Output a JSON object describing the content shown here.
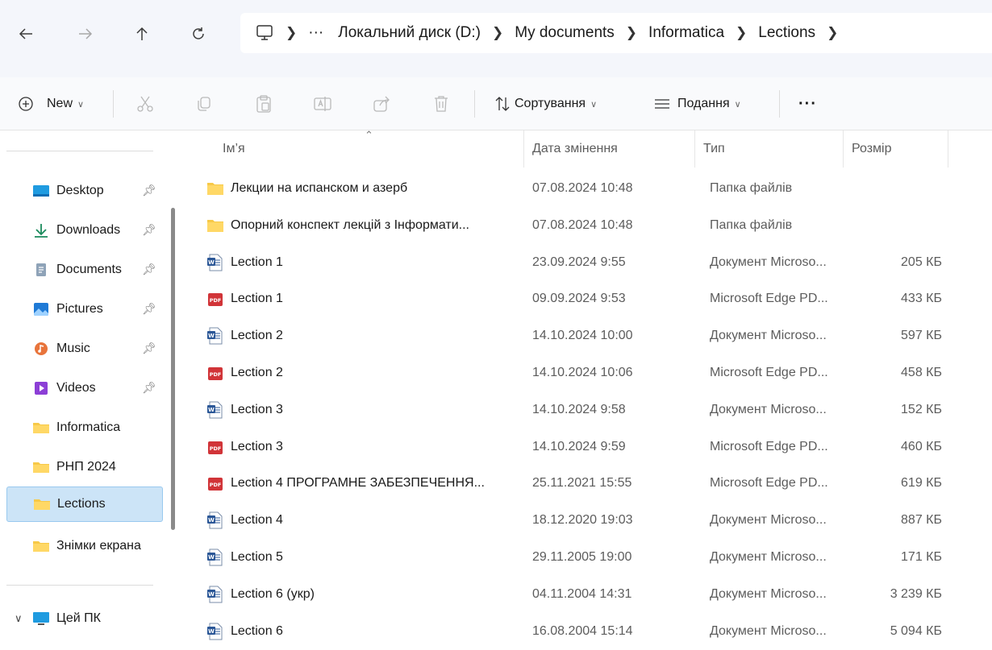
{
  "address_bar": {
    "segments": [
      "Локальний диск (D:)",
      "My documents",
      "Informatica",
      "Lections"
    ],
    "ellipsis": "···"
  },
  "toolbar": {
    "new_label": "New",
    "sort_label": "Сортування",
    "view_label": "Подання",
    "more_label": "···"
  },
  "sidebar": {
    "items": [
      {
        "label": "Desktop",
        "icon": "desktop-icon",
        "pinned": true
      },
      {
        "label": "Downloads",
        "icon": "download-icon",
        "pinned": true
      },
      {
        "label": "Documents",
        "icon": "documents-icon",
        "pinned": true
      },
      {
        "label": "Pictures",
        "icon": "pictures-icon",
        "pinned": true
      },
      {
        "label": "Music",
        "icon": "music-icon",
        "pinned": true
      },
      {
        "label": "Videos",
        "icon": "videos-icon",
        "pinned": true
      },
      {
        "label": "Informatica",
        "icon": "folder-icon",
        "pinned": false
      },
      {
        "label": "РНП 2024",
        "icon": "folder-icon",
        "pinned": false
      },
      {
        "label": "Lections",
        "icon": "folder-icon",
        "pinned": false,
        "selected": true
      },
      {
        "label": "Знімки екрана",
        "icon": "folder-icon",
        "pinned": false
      }
    ],
    "this_pc": "Цей ПК"
  },
  "columns": {
    "name": "Ім’я",
    "date": "Дата змінення",
    "type": "Тип",
    "size": "Розмір"
  },
  "files": [
    {
      "name": "Лекции на испанском и азерб",
      "date": "07.08.2024 10:48",
      "type": "Папка файлів",
      "size": "",
      "icon": "folder"
    },
    {
      "name": "Опорний конспект лекцій з Інформати...",
      "date": "07.08.2024 10:48",
      "type": "Папка файлів",
      "size": "",
      "icon": "folder"
    },
    {
      "name": "Lection 1",
      "date": "23.09.2024 9:55",
      "type": "Документ Microso...",
      "size": "205 КБ",
      "icon": "word"
    },
    {
      "name": "Lection 1",
      "date": "09.09.2024 9:53",
      "type": "Microsoft Edge PD...",
      "size": "433 КБ",
      "icon": "pdf"
    },
    {
      "name": "Lection 2",
      "date": "14.10.2024 10:00",
      "type": "Документ Microso...",
      "size": "597 КБ",
      "icon": "word"
    },
    {
      "name": "Lection 2",
      "date": "14.10.2024 10:06",
      "type": "Microsoft Edge PD...",
      "size": "458 КБ",
      "icon": "pdf"
    },
    {
      "name": "Lection 3",
      "date": "14.10.2024 9:58",
      "type": "Документ Microso...",
      "size": "152 КБ",
      "icon": "word"
    },
    {
      "name": "Lection 3",
      "date": "14.10.2024 9:59",
      "type": "Microsoft Edge PD...",
      "size": "460 КБ",
      "icon": "pdf"
    },
    {
      "name": "Lection 4 ПРОГРАМНЕ  ЗАБЕЗПЕЧЕННЯ...",
      "date": "25.11.2021 15:55",
      "type": "Microsoft Edge PD...",
      "size": "619 КБ",
      "icon": "pdf"
    },
    {
      "name": "Lection 4",
      "date": "18.12.2020 19:03",
      "type": "Документ Microso...",
      "size": "887 КБ",
      "icon": "word"
    },
    {
      "name": "Lection 5",
      "date": "29.11.2005 19:00",
      "type": "Документ Microso...",
      "size": "171 КБ",
      "icon": "word"
    },
    {
      "name": "Lection 6 (укр)",
      "date": "04.11.2004 14:31",
      "type": "Документ Microso...",
      "size": "3 239 КБ",
      "icon": "word"
    },
    {
      "name": "Lection 6",
      "date": "16.08.2004 15:14",
      "type": "Документ Microso...",
      "size": "5 094 КБ",
      "icon": "word"
    }
  ],
  "colors": {
    "accent": "#0067c0",
    "selection": "#cce4f7",
    "folder": "#f7c948",
    "word": "#2b5797",
    "pdf": "#d13438"
  }
}
